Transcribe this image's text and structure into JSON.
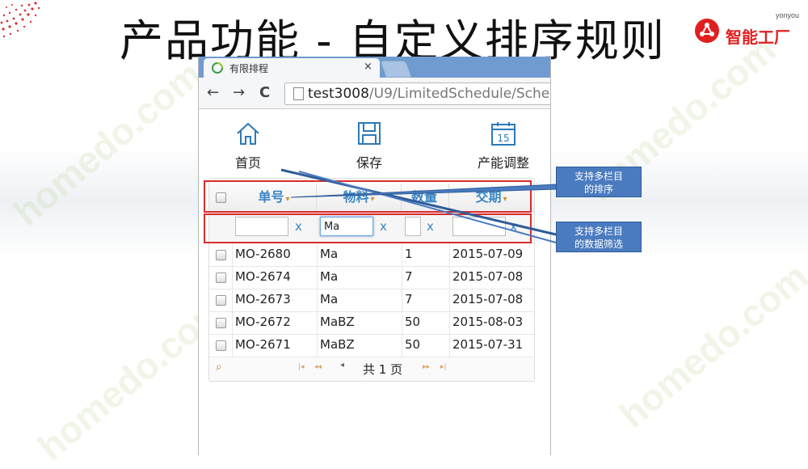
{
  "slide": {
    "title": "产品功能 - 自定义排序规则",
    "brand_sub": "yonyou",
    "brand_name": "智能工厂",
    "accent_color": "#e02020"
  },
  "browser": {
    "tab_title": "有限排程",
    "tab_close": "×",
    "url_host": "test3008",
    "url_path": "/U9/LimitedSchedule/Sche",
    "nav": {
      "back": "←",
      "forward": "→",
      "reload": "C"
    }
  },
  "toolbar": {
    "items": [
      {
        "label": "首页",
        "icon": "home-icon"
      },
      {
        "label": "保存",
        "icon": "save-icon"
      },
      {
        "label": "产能调整",
        "icon": "calendar-icon",
        "icon_text": "15"
      }
    ]
  },
  "grid": {
    "columns": [
      {
        "label": "单号",
        "sort_icon": "▾"
      },
      {
        "label": "物料",
        "sort_icon": "▾"
      },
      {
        "label": "数量",
        "sort_icon": ""
      },
      {
        "label": "交期",
        "sort_icon": "▾"
      }
    ],
    "filters": [
      {
        "value": "",
        "clear": "x"
      },
      {
        "value": "Ma",
        "clear": "x"
      },
      {
        "value": "",
        "clear": "x"
      },
      {
        "value": "",
        "clear": "x"
      }
    ],
    "rows": [
      [
        "MO-2680",
        "Ma",
        "1",
        "2015-07-09"
      ],
      [
        "MO-2674",
        "Ma",
        "7",
        "2015-07-08"
      ],
      [
        "MO-2673",
        "Ma",
        "7",
        "2015-07-08"
      ],
      [
        "MO-2672",
        "MaBZ",
        "50",
        "2015-08-03"
      ],
      [
        "MO-2671",
        "MaBZ",
        "50",
        "2015-07-31"
      ]
    ],
    "pager": {
      "first": "|◂",
      "prev": "◂◂",
      "page_text": "共 1 页",
      "next": "▸▸",
      "last": "▸|"
    }
  },
  "callouts": [
    {
      "line1": "支持多栏目",
      "line2": "的排序"
    },
    {
      "line1": "支持多栏目",
      "line2": "的数据筛选"
    }
  ],
  "watermark": "homedo.com"
}
